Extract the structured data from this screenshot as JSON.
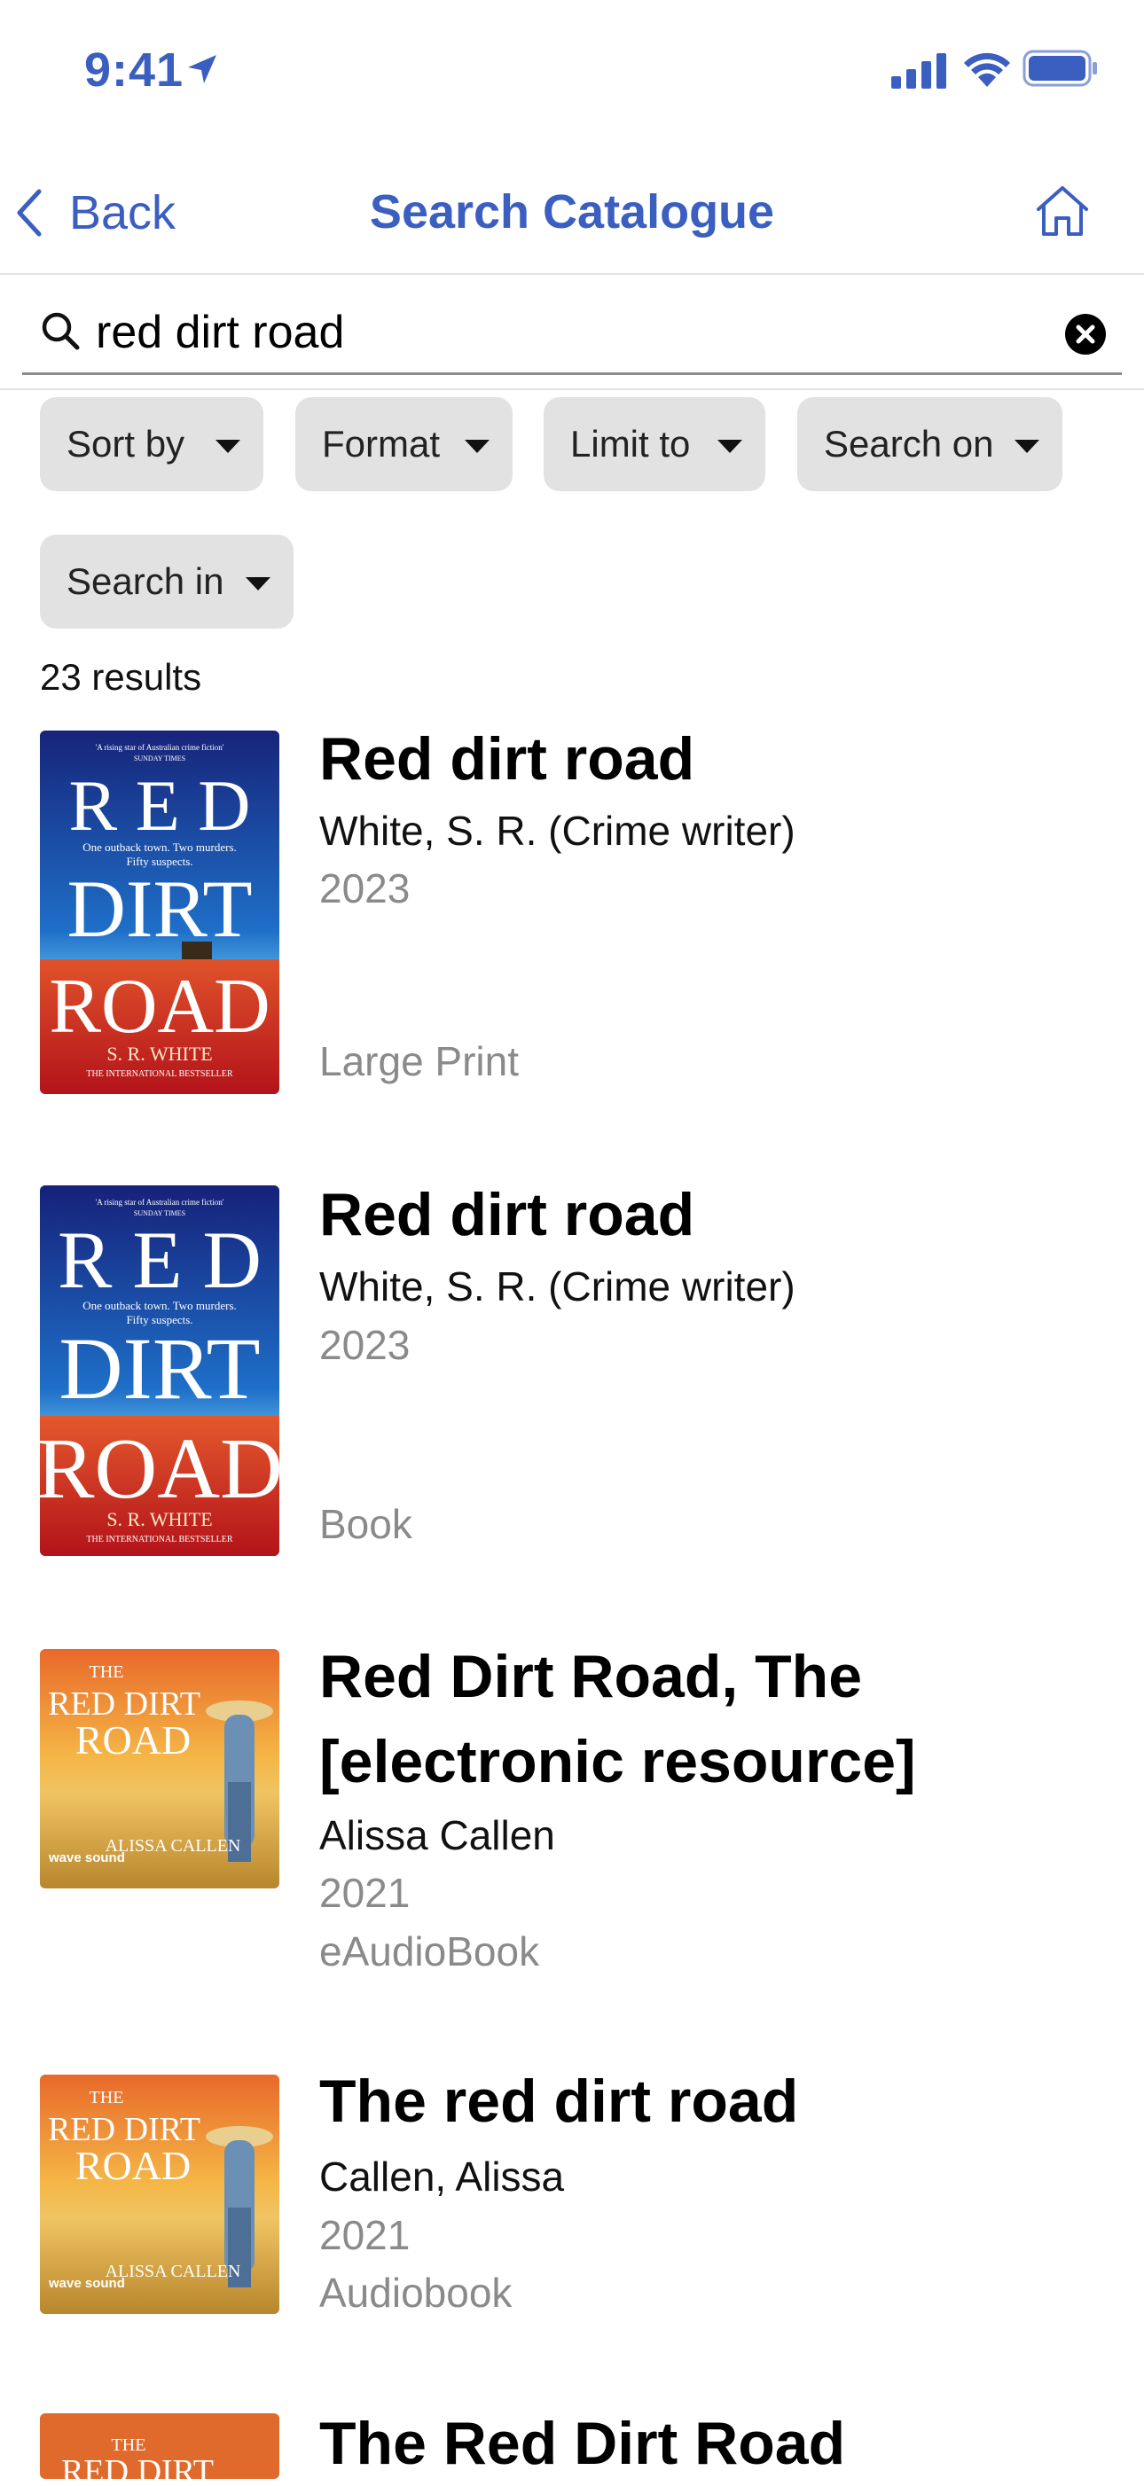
{
  "status_bar": {
    "time": "9:41"
  },
  "nav": {
    "back_label": "Back",
    "title": "Search Catalogue"
  },
  "search": {
    "value": "red dirt road",
    "placeholder": ""
  },
  "filters": [
    "Sort by",
    "Format",
    "Limit to",
    "Search on",
    "Search in"
  ],
  "result_count": "23 results",
  "results": [
    {
      "title": "Red dirt road",
      "author": "White, S. R. (Crime writer)",
      "year": "2023",
      "format": "Large Print"
    },
    {
      "title": "Red dirt road",
      "author": "White, S. R. (Crime writer)",
      "year": "2023",
      "format": "Book"
    },
    {
      "title_line1": "Red Dirt Road, The",
      "title_line2": "[electronic resource]",
      "author": "Alissa Callen",
      "year": "2021",
      "format": "eAudioBook"
    },
    {
      "title": "The red dirt road",
      "author": "Callen, Alissa",
      "year": "2021",
      "format": "Audiobook"
    },
    {
      "title": "The Red Dirt Road"
    }
  ],
  "covers": {
    "white": {
      "tagline": "'A rising star of Australian crime fiction'",
      "source": "SUNDAY TIMES",
      "line1": "R E D",
      "blurb": "One outback town. Two murders. Fifty suspects.",
      "line2": "DIRT",
      "line3": "ROAD",
      "author": "S. R. WHITE",
      "footer": "THE INTERNATIONAL BESTSELLER"
    },
    "callen": {
      "the": "THE",
      "red_dirt": "RED DIRT",
      "road": "ROAD",
      "author": "ALISSA CALLEN",
      "publisher": "wave sound"
    }
  },
  "colors": {
    "accent": "#3b5ec1",
    "chip_bg": "#e2e2e2",
    "muted_text": "#8a8a8a"
  }
}
